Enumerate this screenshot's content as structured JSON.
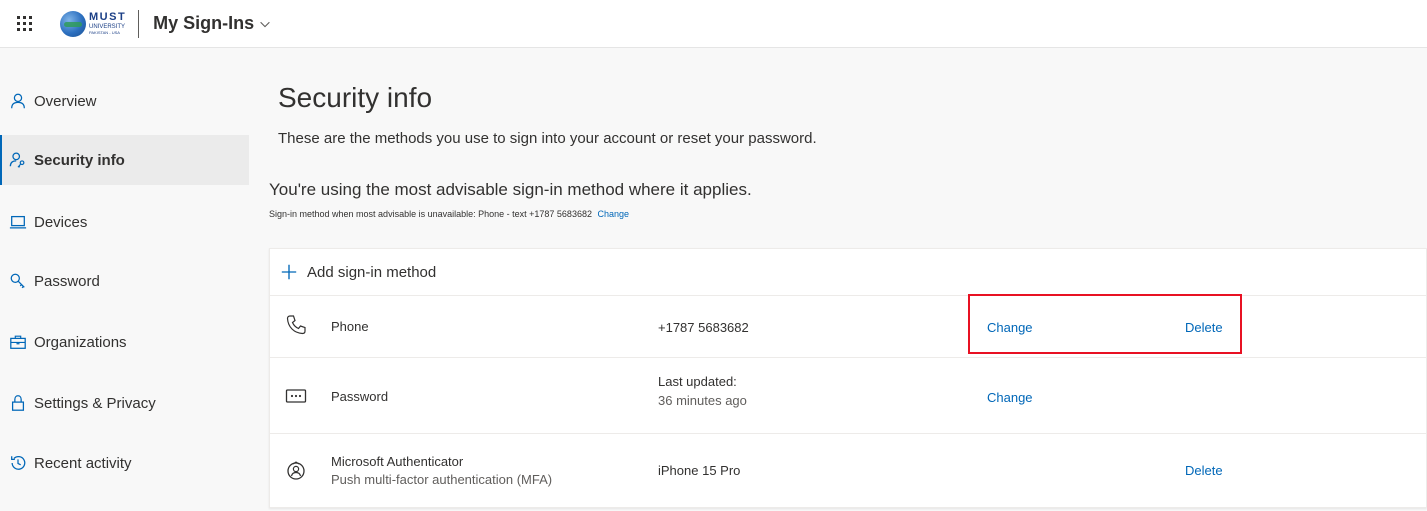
{
  "header": {
    "logo_line1": "MUST",
    "logo_line2": "UNIVERSITY",
    "logo_line3": "PAKISTAN - USA",
    "app_title": "My Sign-Ins"
  },
  "sidebar": {
    "items": [
      {
        "label": "Overview",
        "icon": "person-icon",
        "active": false
      },
      {
        "label": "Security info",
        "icon": "security-person-icon",
        "active": true
      },
      {
        "label": "Devices",
        "icon": "laptop-icon",
        "active": false
      },
      {
        "label": "Password",
        "icon": "key-icon",
        "active": false
      },
      {
        "label": "Organizations",
        "icon": "briefcase-icon",
        "active": false
      },
      {
        "label": "Settings & Privacy",
        "icon": "lock-icon",
        "active": false
      },
      {
        "label": "Recent activity",
        "icon": "history-icon",
        "active": false
      }
    ]
  },
  "main": {
    "title": "Security info",
    "subtitle": "These are the methods you use to sign into your account or reset your password.",
    "advise_title": "You're using the most advisable sign-in method where it applies.",
    "advise_sub": "Sign-in method when most advisable is unavailable: Phone - text +1787 5683682",
    "advise_change": "Change",
    "add_method": "Add sign-in method",
    "methods": [
      {
        "icon": "phone-icon",
        "name": "Phone",
        "desc": "",
        "detail": "+1787 5683682",
        "detail2": "",
        "change": "Change",
        "delete": "Delete"
      },
      {
        "icon": "password-icon",
        "name": "Password",
        "desc": "",
        "detail": "Last updated:",
        "detail2": "36 minutes ago",
        "change": "Change",
        "delete": ""
      },
      {
        "icon": "authenticator-icon",
        "name": "Microsoft Authenticator",
        "desc": "Push multi-factor authentication (MFA)",
        "detail": "iPhone 15 Pro",
        "detail2": "",
        "change": "",
        "delete": "Delete"
      }
    ]
  },
  "colors": {
    "accent": "#0067b8",
    "highlight": "#e81123",
    "text": "#323130"
  }
}
